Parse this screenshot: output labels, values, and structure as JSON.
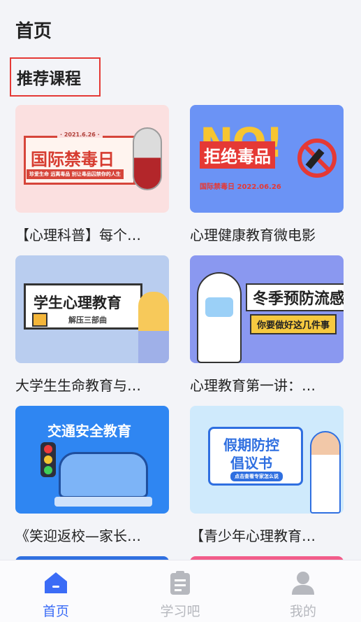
{
  "header": {
    "title": "首页"
  },
  "section": {
    "title": "推荐课程"
  },
  "courses": [
    {
      "caption": "【心理科普】每个…",
      "thumb_title": "国际禁毒日",
      "thumb_date": "· 2021.6.26 ·",
      "thumb_sub": "珍爱生命 远离毒品 别让毒品囚禁你的人生"
    },
    {
      "caption": "心理健康教育微电影",
      "thumb_title": "拒绝毒品",
      "thumb_badge": "NO!",
      "thumb_sub": "国际禁毒日 2022.06.26"
    },
    {
      "caption": "大学生生命教育与…",
      "thumb_title": "学生心理教育",
      "thumb_sub": "解压三部曲"
    },
    {
      "caption": "心理教育第一讲：…",
      "thumb_title": "冬季预防流感",
      "thumb_sub": "你要做好这几件事"
    },
    {
      "caption": "《笑迎返校—家长…",
      "thumb_title": "交通安全教育"
    },
    {
      "caption": "【青少年心理教育…",
      "thumb_title": "假期防控",
      "thumb_title2": "倡议书",
      "thumb_sub": "点击查看专家怎么说"
    }
  ],
  "tabbar": {
    "tabs": [
      {
        "label": "首页",
        "icon": "home-icon",
        "active": true
      },
      {
        "label": "学习吧",
        "icon": "clipboard-icon",
        "active": false
      },
      {
        "label": "我的",
        "icon": "user-icon",
        "active": false
      }
    ]
  },
  "colors": {
    "accent": "#3b6cf6",
    "inactive": "#b6b8be",
    "highlight_border": "#e53935"
  }
}
